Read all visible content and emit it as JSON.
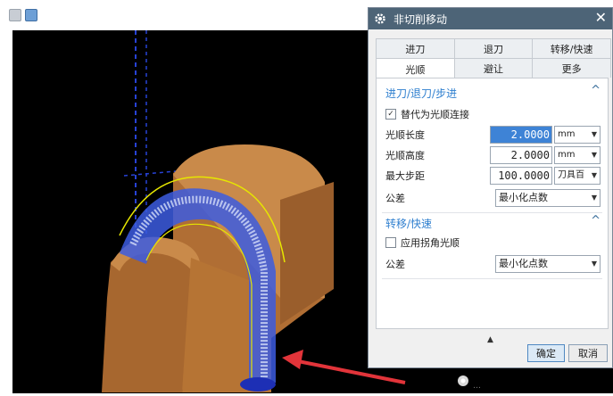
{
  "dialog": {
    "title": "非切削移动",
    "close_label": "✕",
    "tabs_row1": [
      "进刀",
      "退刀",
      "转移/快速"
    ],
    "tabs_row2": [
      "光顺",
      "避让",
      "更多"
    ],
    "active_tab": "光顺",
    "section1": {
      "title": "进刀/退刀/步进",
      "replace_checkbox": {
        "label": "替代为光顺连接",
        "checked": true,
        "mark": "✓"
      },
      "smooth_length": {
        "label": "光顺长度",
        "value": "2.0000",
        "unit": "mm"
      },
      "smooth_height": {
        "label": "光顺高度",
        "value": "2.0000",
        "unit": "mm"
      },
      "max_step": {
        "label": "最大步距",
        "value": "100.0000",
        "unit": "刀具百"
      },
      "tolerance": {
        "label": "公差",
        "value": "最小化点数"
      }
    },
    "section2": {
      "title": "转移/快速",
      "corner_checkbox": {
        "label": "应用拐角光顺",
        "checked": false
      },
      "tolerance": {
        "label": "公差",
        "value": "最小化点数"
      }
    },
    "collapse_glyph": "▲",
    "ok_label": "确定",
    "cancel_label": "取消"
  },
  "glyphs": {
    "caret_up": "^",
    "dropdown": "▼"
  },
  "below_dialog_text": "…",
  "colors": {
    "viewport": "#000000",
    "titlebar": "#4d6477",
    "part": "#c07a3e",
    "toolpath": "#3c5ce0",
    "arrow": "#e2343a",
    "section_title": "#2f7fcf"
  }
}
